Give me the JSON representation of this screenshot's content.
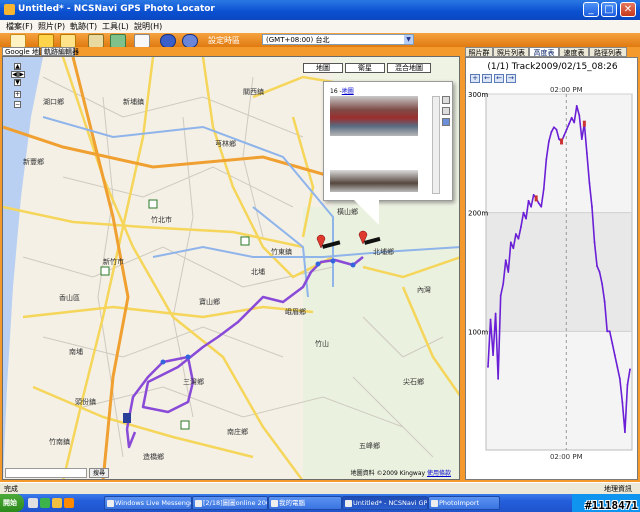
{
  "window": {
    "title": "Untitled* - NCSNavi GPS Photo Locator",
    "controls": {
      "minimize": "_",
      "maximize": "□",
      "close": "✕"
    }
  },
  "menu": [
    "檔案(F)",
    "照片(P)",
    "軌跡(T)",
    "工具(L)",
    "說明(H)"
  ],
  "toolbar": {
    "timezone_label": "設定時區",
    "timezone_value": "(GMT+08:00) 台北"
  },
  "map_tabs": [
    "Google 地圖",
    "軌跡編輯器"
  ],
  "map": {
    "type_buttons": [
      "地圖",
      "衛星",
      "混合地圖"
    ],
    "places": [
      "竹南鎮",
      "南埔",
      "造橋鄉",
      "頭份鎮",
      "北埔鄉",
      "峨眉鄉",
      "寶山鄉",
      "竹東鎮",
      "橫山鄉",
      "芎林鄉",
      "新埔鎮",
      "關西鎮",
      "湖口鄉",
      "新豐鄉",
      "竹北市",
      "新竹市",
      "香山區",
      "竹山",
      "尖石鄉",
      "北埔",
      "三灣鄉",
      "南庄鄉",
      "五峰鄉",
      "內灣"
    ],
    "popup": {
      "number": "16 -",
      "link": "地圖"
    },
    "search_button": "搜尋",
    "copyright": "地圖資料 ©2009 Kingway",
    "terms": "使用條款"
  },
  "right_tabs": [
    "照片群",
    "照片列表",
    "高度表",
    "速度表",
    "路徑列表"
  ],
  "chart_data": {
    "type": "line",
    "title": "(1/1) Track2009/02/15_08:26",
    "y_tick_labels": [
      "300m",
      "200m",
      "100m"
    ],
    "ylim": [
      0,
      300
    ],
    "x_tick_label_top": "02:00 PM",
    "x_tick_label_bottom": "02:00 PM",
    "series": [
      {
        "color": "#6a1fd6",
        "values": [
          70,
          110,
          80,
          115,
          60,
          130,
          140,
          160,
          150,
          175,
          170,
          182,
          178,
          188,
          200,
          195,
          210,
          205,
          215,
          212,
          208,
          205,
          220,
          245,
          260,
          268,
          272,
          270,
          262,
          260,
          265,
          270,
          275,
          280,
          276,
          290,
          282,
          262,
          275,
          250,
          225,
          205,
          175,
          155,
          150,
          140,
          125,
          100,
          100,
          90,
          80,
          70,
          60,
          40,
          15,
          55,
          68
        ]
      }
    ],
    "markers": [
      {
        "index": 19,
        "color": "#c33"
      },
      {
        "index": 38,
        "color": "#c33"
      },
      {
        "index": 29,
        "color": "#c33"
      }
    ]
  },
  "status": {
    "left": "完成",
    "right": "地理資訊"
  },
  "taskbar": {
    "start": "開始",
    "tasks": [
      "Windows Live Messenger",
      "[2/18]圖圖online 2008T...",
      "我的電腦",
      "Untitled* - NCSNavi GPS...",
      "PhotoImport"
    ]
  },
  "watermark": "#1118471"
}
